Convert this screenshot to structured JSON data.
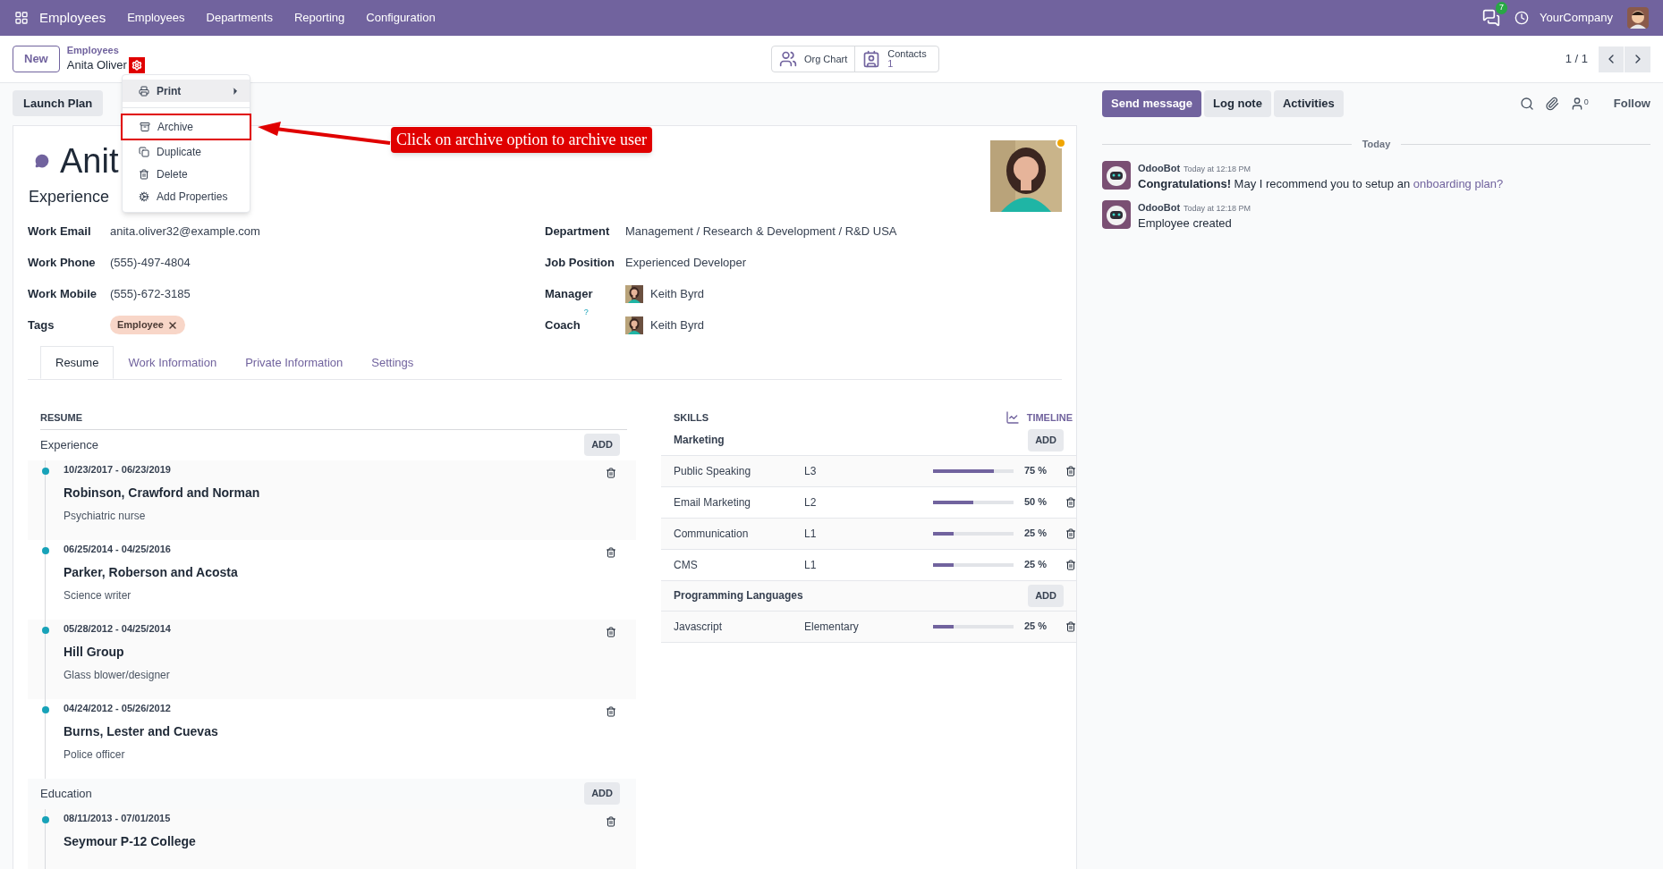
{
  "navbar": {
    "app_name": "Employees",
    "menu": [
      "Employees",
      "Departments",
      "Reporting",
      "Configuration"
    ],
    "message_count": "7",
    "company": "YourCompany"
  },
  "control_panel": {
    "new_button": "New",
    "breadcrumb": "Employees",
    "record_name": "Anita Oliver",
    "smart_buttons": [
      {
        "label": "Org Chart"
      },
      {
        "label": "Contacts",
        "count": "1"
      }
    ],
    "pager": "1 / 1"
  },
  "action_menu": {
    "items": [
      {
        "label": "Print",
        "submenu": true,
        "highlighted": true
      },
      {
        "label": "Archive",
        "submenu": false,
        "highlighted": false
      },
      {
        "label": "Duplicate",
        "submenu": false,
        "highlighted": false
      },
      {
        "label": "Delete",
        "submenu": false,
        "highlighted": false
      },
      {
        "label": "Add Properties",
        "submenu": false,
        "highlighted": false
      }
    ]
  },
  "annotation": {
    "text": "Click on archive option to archive user"
  },
  "launch_plan": "Launch Plan",
  "employee": {
    "name": "Anit",
    "job_title": "Experience"
  },
  "fields_left": [
    {
      "kind": "text",
      "label": "Work Email",
      "value": "anita.oliver32@example.com"
    },
    {
      "kind": "text",
      "label": "Work Phone",
      "value": "(555)-497-4804"
    },
    {
      "kind": "text",
      "label": "Work Mobile",
      "value": "(555)-672-3185"
    },
    {
      "kind": "tags",
      "label": "Tags",
      "value": "Employee"
    }
  ],
  "fields_right": [
    {
      "kind": "text",
      "label": "Department",
      "value": "Management / Research & Development / R&D USA"
    },
    {
      "kind": "text",
      "label": "Job Position",
      "value": "Experienced Developer"
    },
    {
      "kind": "person",
      "label": "Manager",
      "value": "Keith Byrd"
    },
    {
      "kind": "person",
      "label": "Coach",
      "help": "?",
      "value": "Keith Byrd"
    }
  ],
  "tabs": [
    {
      "label": "Resume",
      "selected": true
    },
    {
      "label": "Work Information",
      "selected": false
    },
    {
      "label": "Private Information",
      "selected": false
    },
    {
      "label": "Settings",
      "selected": false
    }
  ],
  "resume": {
    "title": "RESUME",
    "sections": [
      {
        "name": "Experience",
        "add": "ADD",
        "entries": [
          {
            "dates": "10/23/2017 - 06/23/2019",
            "company": "Robinson, Crawford and Norman",
            "role": "Psychiatric nurse"
          },
          {
            "dates": "06/25/2014 - 04/25/2016",
            "company": "Parker, Roberson and Acosta",
            "role": "Science writer"
          },
          {
            "dates": "05/28/2012 - 04/25/2014",
            "company": "Hill Group",
            "role": "Glass blower/designer"
          },
          {
            "dates": "04/24/2012 - 05/26/2012",
            "company": "Burns, Lester and Cuevas",
            "role": "Police officer"
          }
        ]
      },
      {
        "name": "Education",
        "add": "ADD",
        "entries": [
          {
            "dates": "08/11/2013 - 07/01/2015",
            "company": "Seymour P-12 College"
          }
        ]
      }
    ]
  },
  "skills": {
    "title": "SKILLS",
    "timeline": "TIMELINE",
    "groups": [
      {
        "name": "Marketing",
        "add": "ADD",
        "skills": [
          {
            "name": "Public Speaking",
            "level_name": "L3",
            "level": 0.75,
            "progress": "75 %"
          },
          {
            "name": "Email Marketing",
            "level_name": "L2",
            "level": 0.5,
            "progress": "50 %"
          },
          {
            "name": "Communication",
            "level_name": "L1",
            "level": 0.25,
            "progress": "25 %"
          },
          {
            "name": "CMS",
            "level_name": "L1",
            "level": 0.25,
            "progress": "25 %"
          }
        ]
      },
      {
        "name": "Programming Languages",
        "add": "ADD",
        "skills": [
          {
            "name": "Javascript",
            "level_name": "Elementary",
            "level": 0.25,
            "progress": "25 %"
          }
        ]
      }
    ]
  },
  "chatter": {
    "buttons": [
      {
        "label": "Send message",
        "selected": true
      },
      {
        "label": "Log note",
        "selected": false
      },
      {
        "label": "Activities",
        "selected": false
      }
    ],
    "follower_count": "0",
    "follow": "Follow",
    "date_separator": "Today",
    "messages": [
      {
        "author": "OdooBot",
        "time": "Today at 12:18 PM",
        "body": "**Congratulations!** May I recommend you to setup an",
        "link": "onboarding plan?"
      },
      {
        "author": "OdooBot",
        "time": "Today at 12:18 PM",
        "body": "Employee created"
      }
    ]
  }
}
